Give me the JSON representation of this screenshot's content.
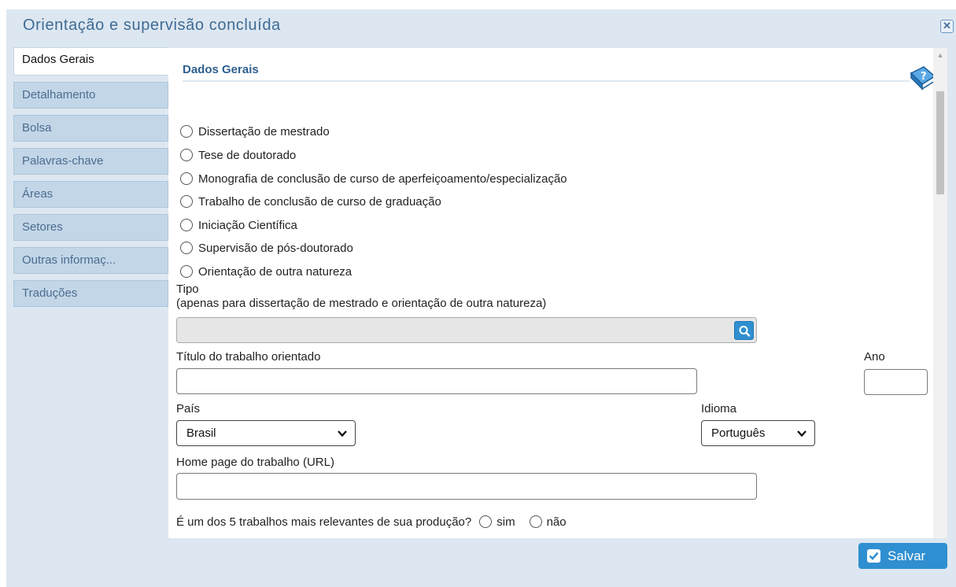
{
  "dialog": {
    "title": "Orientação e supervisão concluída",
    "close_icon": "close-icon"
  },
  "tabs": [
    {
      "label": "Dados Gerais",
      "active": true
    },
    {
      "label": "Detalhamento",
      "active": false
    },
    {
      "label": "Bolsa",
      "active": false
    },
    {
      "label": "Palavras-chave",
      "active": false
    },
    {
      "label": "Áreas",
      "active": false
    },
    {
      "label": "Setores",
      "active": false
    },
    {
      "label": "Outras informaç...",
      "active": false
    },
    {
      "label": "Traduções",
      "active": false
    }
  ],
  "section": {
    "title": "Dados Gerais",
    "help_icon": "help-book-icon"
  },
  "orientation_types": [
    "Dissertação de mestrado",
    "Tese de doutorado",
    "Monografia de conclusão de curso de aperfeiçoamento/especialização",
    "Trabalho de conclusão de curso de graduação",
    "Iniciação Científica",
    "Supervisão de pós-doutorado",
    "Orientação de outra natureza"
  ],
  "tipo": {
    "label": "Tipo",
    "hint": "(apenas para dissertação de mestrado e orientação de outra natureza)",
    "value": "",
    "search_icon": "search-icon"
  },
  "titulo": {
    "label": "Título do trabalho orientado",
    "value": ""
  },
  "ano": {
    "label": "Ano",
    "value": ""
  },
  "pais": {
    "label": "País",
    "selected": "Brasil"
  },
  "idioma": {
    "label": "Idioma",
    "selected": "Português"
  },
  "homepage": {
    "label": "Home page do trabalho (URL)",
    "value": ""
  },
  "relevance": {
    "question": "É um dos 5 trabalhos mais relevantes de sua produção?",
    "options": [
      "sim",
      "não"
    ]
  },
  "footer": {
    "save_label": "Salvar"
  },
  "colors": {
    "accent": "#2f8fd0",
    "title": "#3e6b95",
    "dialog_bg": "#dde7f1"
  }
}
